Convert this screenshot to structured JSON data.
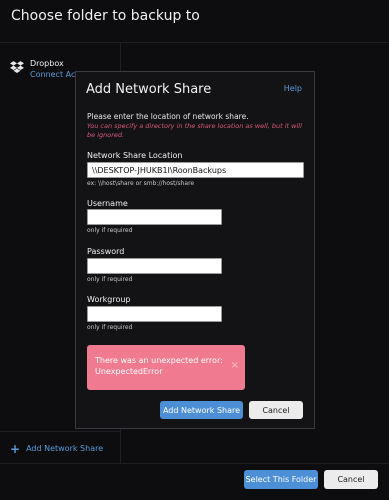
{
  "window": {
    "title": "Choose folder to backup to"
  },
  "sidebar": {
    "dropbox": {
      "name": "Dropbox",
      "link": "Connect Account"
    },
    "add_share": "Add Network Share"
  },
  "footer": {
    "select_label": "Select This Folder",
    "cancel_label": "Cancel"
  },
  "modal": {
    "title": "Add Network Share",
    "help": "Help",
    "intro": "Please enter the location of network share.",
    "hint": "You can specify a directory in the share location as well, but it will be ignored.",
    "location": {
      "label": "Network Share Location",
      "value": "\\\\DESKTOP-JHUKB1I\\RoonBackups",
      "example": "ex: \\\\host\\share or smb://host/share"
    },
    "username": {
      "label": "Username",
      "value": "",
      "hint": "only if required"
    },
    "password": {
      "label": "Password",
      "value": "",
      "hint": "only if required"
    },
    "workgroup": {
      "label": "Workgroup",
      "value": "",
      "hint": "only if required"
    },
    "error": {
      "message": "There was an unexpected error: UnexpectedError",
      "close": "×"
    },
    "add_label": "Add Network Share",
    "cancel_label": "Cancel"
  },
  "colors": {
    "accent": "#4d8fd6",
    "error": "#f07a90",
    "background": "#0d0d0f"
  }
}
